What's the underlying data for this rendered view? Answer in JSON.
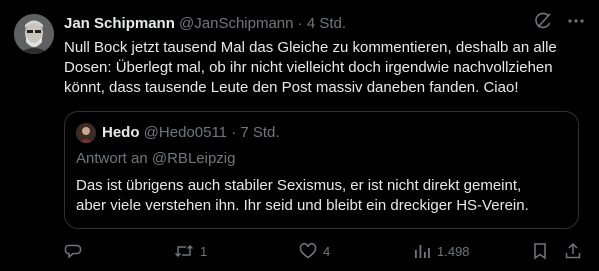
{
  "tweet": {
    "author_name": "Jan Schipmann",
    "handle": "@JanSchipmann",
    "separator": "·",
    "time": "4 Std.",
    "text": "Null Bock jetzt tausend Mal das Gleiche zu kommentieren, deshalb an alle\nDosen: Überlegt mal, ob ihr nicht vielleicht doch irgendwie nachvollziehen\nkönnt, dass tausende Leute den Post massiv daneben fanden. Ciao!",
    "header_icons": [
      "grok-icon",
      "more-icon"
    ]
  },
  "quote": {
    "author_name": "Hedo",
    "handle": "@Hedo0511",
    "separator": "·",
    "time": "7 Std.",
    "reply_prefix": "Antwort an ",
    "reply_handle": "@RBLeipzig",
    "text": "Das ist übrigens auch stabiler Sexismus, er ist nicht direkt gemeint,\naber viele verstehen ihn. Ihr seid und bleibt ein dreckiger HS-Verein."
  },
  "actions": {
    "reply_count": "",
    "retweet_count": "1",
    "like_count": "4",
    "views_count": "1.498"
  },
  "colors": {
    "background": "#000000",
    "text": "#e7e9ea",
    "muted": "#71767b",
    "border": "#2f3336"
  }
}
